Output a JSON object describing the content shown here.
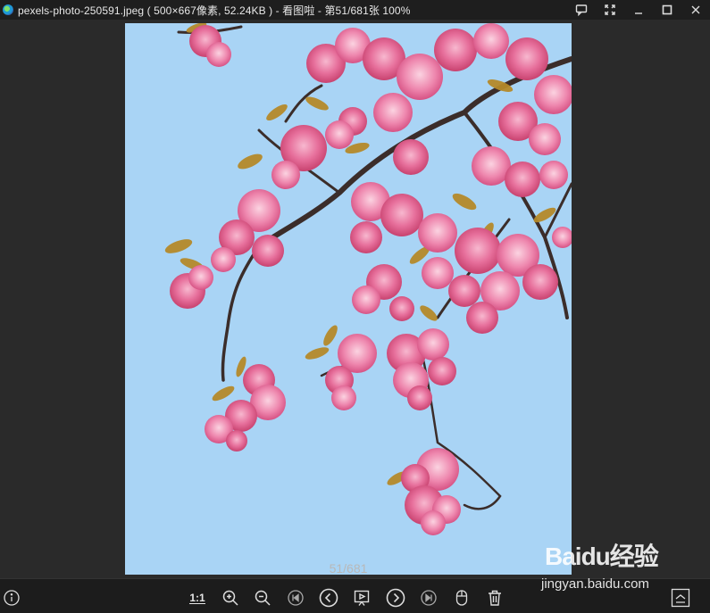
{
  "window": {
    "title": "pexels-photo-250591.jpeg ( 500×667像素, 52.24KB ) - 看图啦 - 第51/681张 100%",
    "controls": [
      "chat-icon",
      "fullscreen-icon",
      "minimize-icon",
      "maximize-icon",
      "close-icon"
    ]
  },
  "viewer": {
    "counter": "51/681"
  },
  "toolbar": {
    "info_icon": "info-icon",
    "ratio_label": "1:1",
    "buttons": [
      "zoom-in-icon",
      "zoom-out-icon",
      "first-image-icon",
      "previous-icon",
      "slideshow-icon",
      "next-icon",
      "last-image-icon",
      "mouse-icon",
      "delete-icon",
      "collapse-panel-icon"
    ]
  },
  "watermark": {
    "logo": "Bai",
    "logo_du": "du",
    "logo_suffix": "经验",
    "site": "jingyan.baidu.com"
  },
  "colors": {
    "sky": "#a9d4f5",
    "blossom": "#e86a98",
    "branch": "#3b2d2a",
    "leaf": "#b58a2a",
    "background": "#2a2a2a"
  }
}
